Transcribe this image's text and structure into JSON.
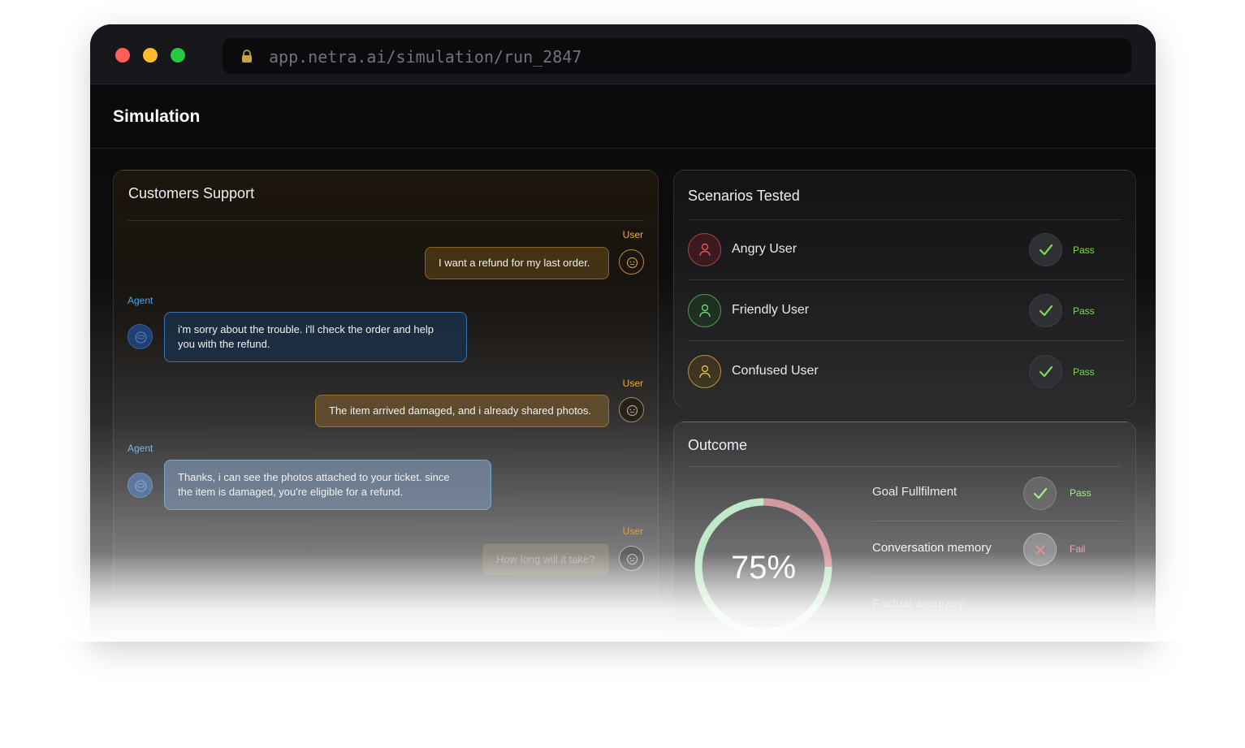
{
  "browser": {
    "url": "app.netra.ai/simulation/run_2847"
  },
  "page": {
    "title": "Simulation"
  },
  "chat": {
    "title": "Customers Support",
    "messages": [
      {
        "role": "user",
        "role_label": "User",
        "text": "I want a refund for my last order."
      },
      {
        "role": "agent",
        "role_label": "Agent",
        "line1": "i'm sorry about the trouble. i'll check the order and help",
        "line2": "you with the refund."
      },
      {
        "role": "user",
        "role_label": "User",
        "text": "The item arrived damaged, and i already shared photos."
      },
      {
        "role": "agent",
        "role_label": "Agent",
        "line1": "Thanks, i can see the photos attached to your ticket. since",
        "line2": "the item is damaged, you're eligible for a refund."
      },
      {
        "role": "user",
        "role_label": "User",
        "text": "How long will it take?"
      },
      {
        "role": "agent",
        "role_label": "Agent"
      }
    ]
  },
  "scenarios": {
    "title": "Scenarios Tested",
    "items": [
      {
        "name": "Angry User",
        "status": "Pass",
        "color": "#e0555a"
      },
      {
        "name": "Friendly User",
        "status": "Pass",
        "color": "#6fd07a"
      },
      {
        "name": "Confused User",
        "status": "Pass",
        "color": "#e2b64a"
      }
    ]
  },
  "outcome": {
    "title": "Outcome",
    "score_label": "75%",
    "score": 0.75,
    "metrics": [
      {
        "name": "Goal Fullfilment",
        "status": "Pass"
      },
      {
        "name": "Conversation memory",
        "status": "Fail"
      },
      {
        "name": "Factual accuracy",
        "status": ""
      }
    ]
  },
  "colors": {
    "pass": "#7ed957",
    "fail": "#ff6b6b",
    "user_accent": "#f4a93a",
    "agent_accent": "#4aa6ea"
  }
}
